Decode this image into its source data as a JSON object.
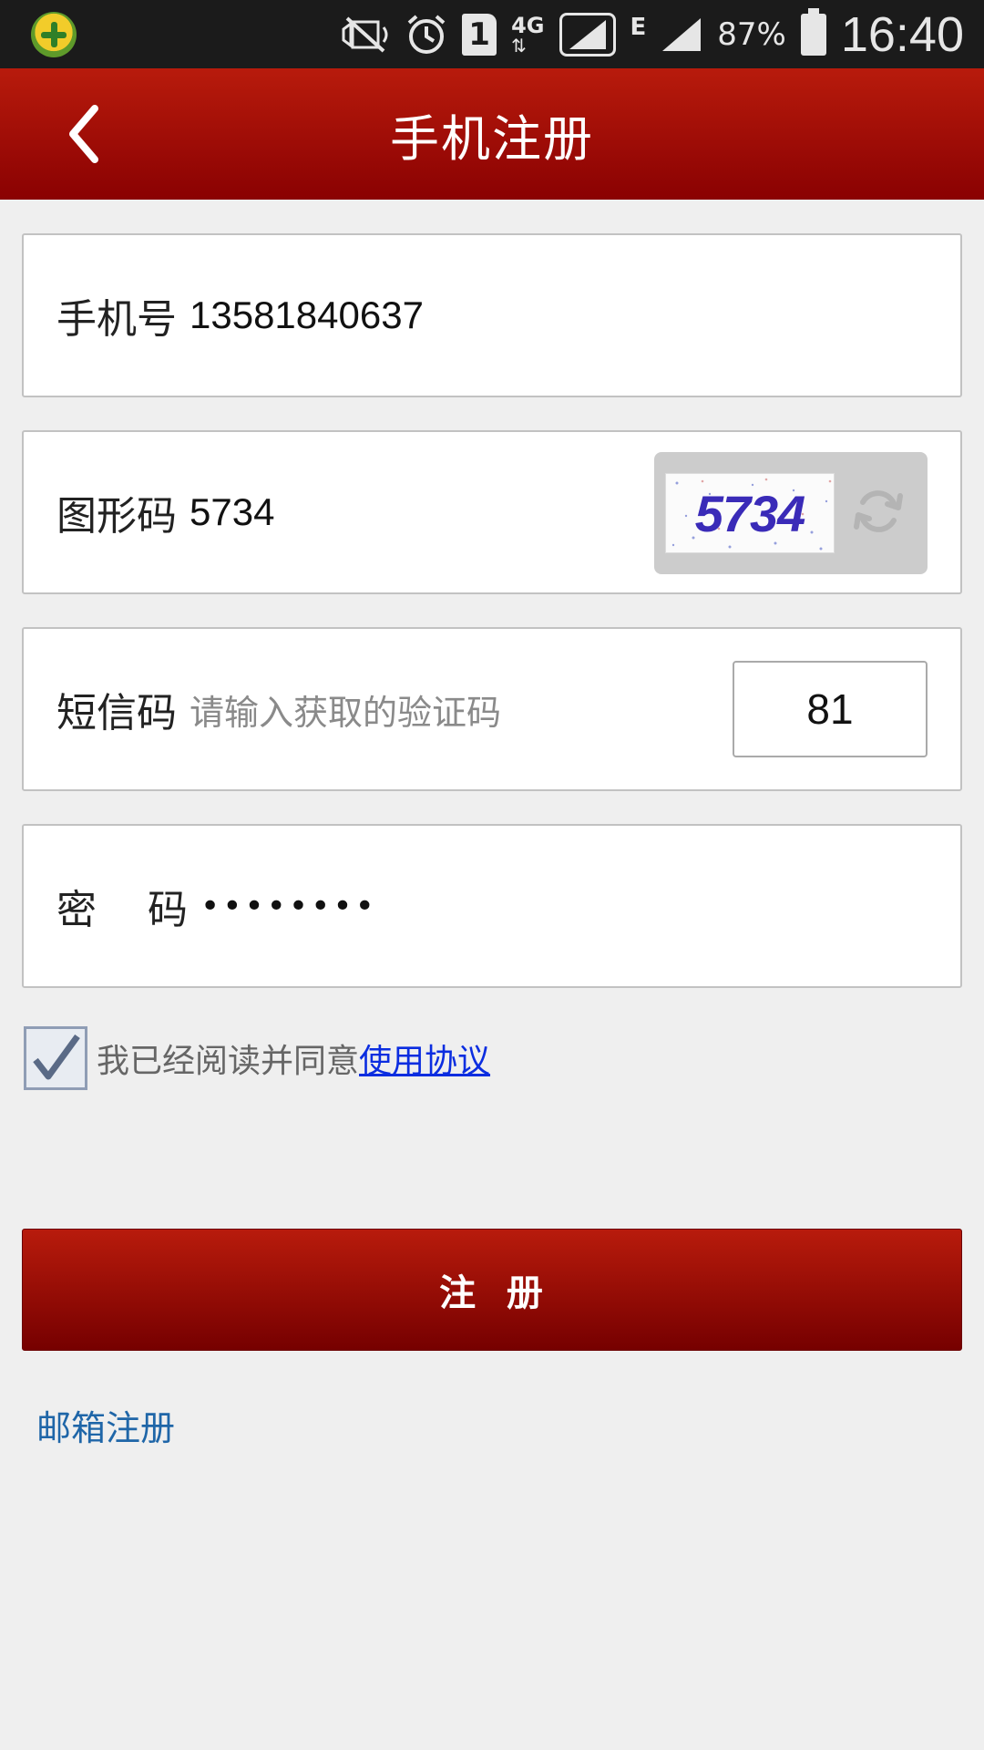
{
  "status_bar": {
    "network": "4G",
    "sim": "1",
    "secondary_network": "E",
    "battery": "87%",
    "time": "16:40",
    "icons": [
      "app-icon",
      "mute-icon",
      "alarm-icon",
      "sim-icon",
      "signal-icon",
      "battery-icon"
    ]
  },
  "header": {
    "title": "手机注册",
    "back_icon": "chevron-left-icon"
  },
  "form": {
    "phone": {
      "label": "手机号",
      "value": "13581840637"
    },
    "captcha": {
      "label": "图形码",
      "value": "5734",
      "image_text": "5734",
      "refresh_icon": "refresh-icon"
    },
    "sms": {
      "label": "短信码",
      "placeholder": "请输入获取的验证码",
      "button": "81"
    },
    "password": {
      "label": "密    码",
      "value": "••••••••"
    }
  },
  "agreement": {
    "checked": true,
    "text": "我已经阅读并同意",
    "link": "使用协议"
  },
  "register_button": "注  册",
  "email_register_link": "邮箱注册",
  "colors": {
    "header": "#a00b05",
    "button": "#9a0a04",
    "link": "#1f66a8",
    "agreement_link": "#0b2de0",
    "background": "#efefef"
  }
}
